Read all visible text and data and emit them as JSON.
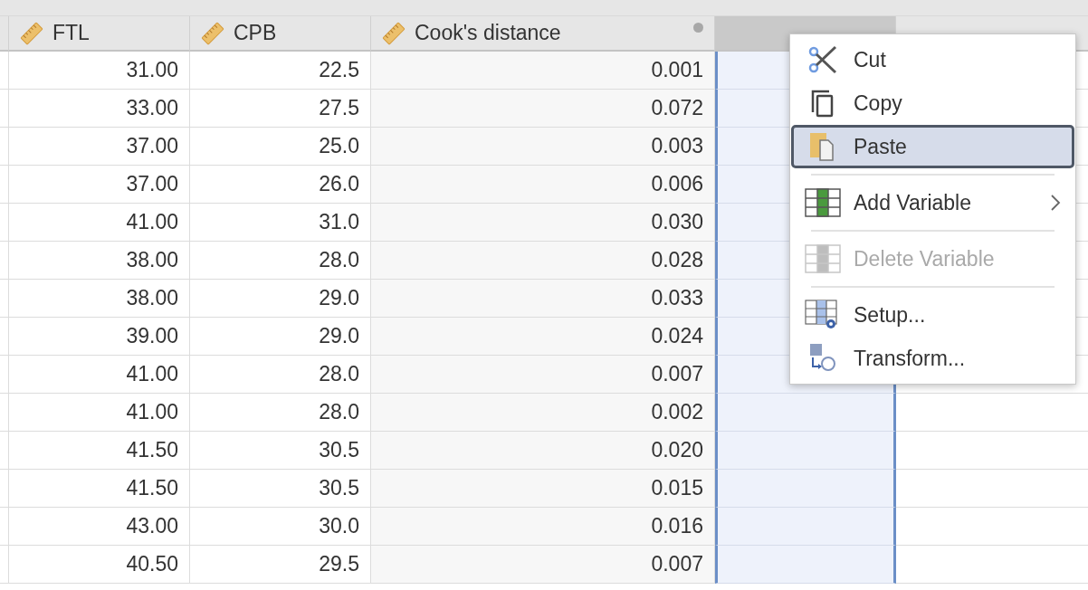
{
  "columns": [
    {
      "name": "FTL",
      "kind": "continuous",
      "computed": false,
      "selected": false
    },
    {
      "name": "CPB",
      "kind": "continuous",
      "computed": false,
      "selected": false
    },
    {
      "name": "Cook's distance",
      "kind": "continuous",
      "computed": true,
      "selected": false
    },
    {
      "kind": "blank",
      "computed": false,
      "selected": true
    },
    {
      "kind": "blank",
      "computed": false,
      "selected": false
    }
  ],
  "rows": [
    [
      "31.00",
      "22.5",
      "0.001"
    ],
    [
      "33.00",
      "27.5",
      "0.072"
    ],
    [
      "37.00",
      "25.0",
      "0.003"
    ],
    [
      "37.00",
      "26.0",
      "0.006"
    ],
    [
      "41.00",
      "31.0",
      "0.030"
    ],
    [
      "38.00",
      "28.0",
      "0.028"
    ],
    [
      "38.00",
      "29.0",
      "0.033"
    ],
    [
      "39.00",
      "29.0",
      "0.024"
    ],
    [
      "41.00",
      "28.0",
      "0.007"
    ],
    [
      "41.00",
      "28.0",
      "0.002"
    ],
    [
      "41.50",
      "30.5",
      "0.020"
    ],
    [
      "41.50",
      "30.5",
      "0.015"
    ],
    [
      "43.00",
      "30.0",
      "0.016"
    ],
    [
      "40.50",
      "29.5",
      "0.007"
    ]
  ],
  "context_menu": [
    {
      "kind": "item",
      "label": "Cut",
      "selected": false,
      "disabled": false,
      "submenu": false
    },
    {
      "kind": "item",
      "label": "Copy",
      "selected": false,
      "disabled": false,
      "submenu": false
    },
    {
      "kind": "item",
      "label": "Paste",
      "selected": true,
      "disabled": false,
      "submenu": false
    },
    {
      "kind": "separator"
    },
    {
      "kind": "item",
      "label": "Add Variable",
      "selected": false,
      "disabled": false,
      "submenu": true
    },
    {
      "kind": "separator"
    },
    {
      "kind": "item",
      "label": "Delete Variable",
      "selected": false,
      "disabled": true,
      "submenu": false
    },
    {
      "kind": "separator"
    },
    {
      "kind": "item",
      "label": "Setup...",
      "selected": false,
      "disabled": false,
      "submenu": false
    },
    {
      "kind": "item",
      "label": "Transform...",
      "selected": false,
      "disabled": false,
      "submenu": false
    }
  ]
}
